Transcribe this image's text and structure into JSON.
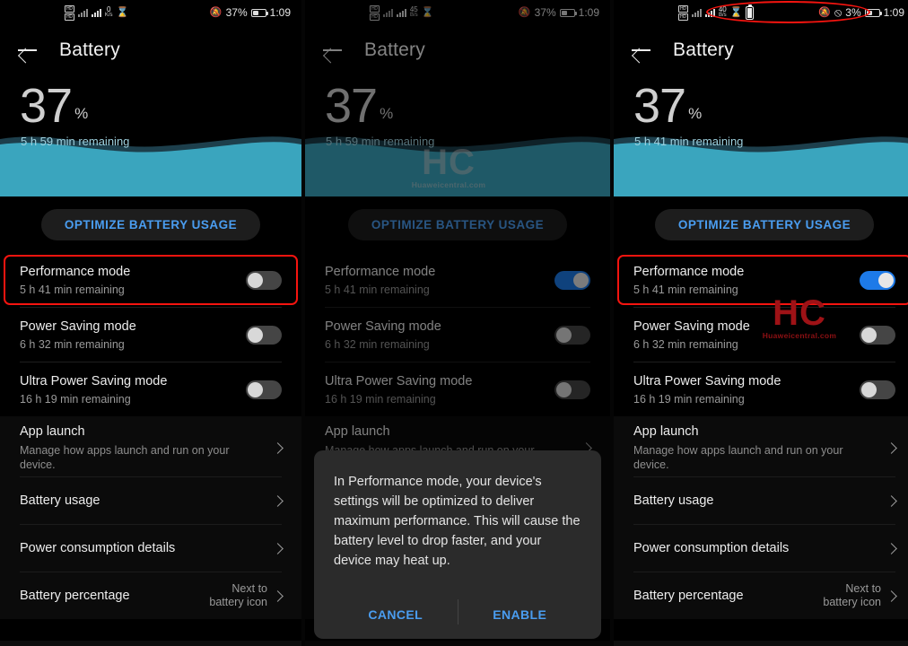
{
  "panels": [
    {
      "id": "panel-1",
      "statusbar": {
        "sim1": "HD",
        "sim2": "HD",
        "net_speed_value": "0",
        "net_speed_unit": "K/s",
        "mute_icon": "bell-muted-icon",
        "hourglass_icon": "hourglass-icon",
        "battery_percent": "37%",
        "clock": "1:09",
        "highlight": false
      },
      "title": "Battery",
      "back_icon": "back-arrow-icon",
      "hero": {
        "percent": "37",
        "percent_symbol": "%",
        "remaining": "5 h 59 min remaining"
      },
      "optimize_button": "OPTIMIZE BATTERY USAGE",
      "modes": [
        {
          "label": "Performance mode",
          "sub": "5 h 41 min remaining",
          "on": false,
          "highlighted": true
        },
        {
          "label": "Power Saving mode",
          "sub": "6 h 32 min remaining",
          "on": false,
          "highlighted": false
        },
        {
          "label": "Ultra Power Saving mode",
          "sub": "16 h 19 min remaining",
          "on": false,
          "highlighted": false
        }
      ],
      "nav": [
        {
          "label": "App launch",
          "sub": "Manage how apps launch and run on your device.",
          "value": "",
          "chevron": "chevron-right-icon"
        },
        {
          "label": "Battery usage",
          "sub": "",
          "value": "",
          "chevron": "chevron-right-icon"
        },
        {
          "label": "Power consumption details",
          "sub": "",
          "value": "",
          "chevron": "chevron-right-icon"
        },
        {
          "label": "Battery percentage",
          "sub": "",
          "value": "Next to\nbattery icon",
          "chevron": "chevron-right-icon"
        }
      ],
      "dialog": null,
      "watermark": null,
      "dimmed": false
    },
    {
      "id": "panel-2",
      "statusbar": {
        "sim1": "HD",
        "sim2": "HD",
        "net_speed_value": "45",
        "net_speed_unit": "B/s",
        "mute_icon": "bell-muted-icon",
        "hourglass_icon": "hourglass-icon",
        "battery_percent": "37%",
        "clock": "1:09",
        "highlight": false
      },
      "title": "Battery",
      "back_icon": "back-arrow-icon",
      "hero": {
        "percent": "37",
        "percent_symbol": "%",
        "remaining": "5 h 59 min remaining"
      },
      "optimize_button": "OPTIMIZE BATTERY USAGE",
      "modes": [
        {
          "label": "Performance mode",
          "sub": "5 h 41 min remaining",
          "on": true,
          "highlighted": false
        },
        {
          "label": "Power Saving mode",
          "sub": "6 h 32 min remaining",
          "on": false,
          "highlighted": false
        },
        {
          "label": "Ultra Power Saving mode",
          "sub": "16 h 19 min remaining",
          "on": false,
          "highlighted": false
        }
      ],
      "nav": [
        {
          "label": "App launch",
          "sub": "Manage how apps launch and run on your device.",
          "value": "",
          "chevron": "chevron-right-icon"
        },
        {
          "label": "Battery usage",
          "sub": "",
          "value": "",
          "chevron": "chevron-right-icon"
        },
        {
          "label": "Power consumption details",
          "sub": "",
          "value": "",
          "chevron": "chevron-right-icon"
        },
        {
          "label": "Battery percentage",
          "sub": "",
          "value": "Next to\nbattery icon",
          "chevron": "chevron-right-icon"
        }
      ],
      "dialog": {
        "body": "In Performance mode, your device's settings will be optimized to deliver maximum performance. This will cause the battery level to drop faster, and your device may heat up.",
        "cancel": "CANCEL",
        "confirm": "ENABLE"
      },
      "watermark": {
        "mark": "HC",
        "domain": "Huaweicentral.com",
        "color": "grey"
      },
      "dimmed": true
    },
    {
      "id": "panel-3",
      "statusbar": {
        "sim1": "HD",
        "sim2": "HD",
        "net_speed_value": "40",
        "net_speed_unit": "B/s",
        "mute_icon": "bell-muted-icon",
        "hourglass_icon": "hourglass-icon",
        "performance_icon": "performance-mode-icon",
        "battery_vertical_icon": "battery-vertical-icon",
        "battery_percent": "3%",
        "clock": "1:09",
        "highlight": true
      },
      "title": "Battery",
      "back_icon": "back-arrow-icon",
      "hero": {
        "percent": "37",
        "percent_symbol": "%",
        "remaining": "5 h 41 min remaining"
      },
      "optimize_button": "OPTIMIZE BATTERY USAGE",
      "modes": [
        {
          "label": "Performance mode",
          "sub": "5 h 41 min remaining",
          "on": true,
          "highlighted": true
        },
        {
          "label": "Power Saving mode",
          "sub": "6 h 32 min remaining",
          "on": false,
          "highlighted": false
        },
        {
          "label": "Ultra Power Saving mode",
          "sub": "16 h 19 min remaining",
          "on": false,
          "highlighted": false
        }
      ],
      "nav": [
        {
          "label": "App launch",
          "sub": "Manage how apps launch and run on your device.",
          "value": "",
          "chevron": "chevron-right-icon"
        },
        {
          "label": "Battery usage",
          "sub": "",
          "value": "",
          "chevron": "chevron-right-icon"
        },
        {
          "label": "Power consumption details",
          "sub": "",
          "value": "",
          "chevron": "chevron-right-icon"
        },
        {
          "label": "Battery percentage",
          "sub": "",
          "value": "Next to\nbattery icon",
          "chevron": "chevron-right-icon"
        }
      ],
      "dialog": null,
      "watermark": {
        "mark": "HC",
        "domain": "Huaweicentral.com",
        "color": "red"
      },
      "dimmed": false
    }
  ],
  "colors": {
    "battery_wave": "#3AA5BE",
    "accent_blue": "#4A9DF0",
    "toggle_on": "#1D7AE8",
    "highlight_red": "#F5140F",
    "background": "#000000"
  }
}
